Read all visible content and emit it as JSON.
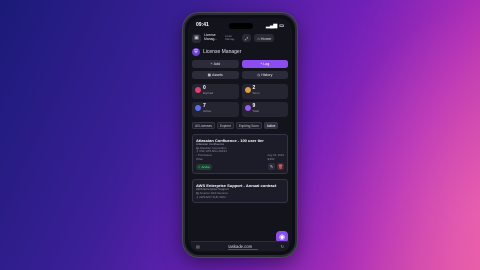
{
  "status": {
    "time": "09:41"
  },
  "topbar": {
    "title_line1": "License",
    "title_line2": "Manag...",
    "subtitle_line1": "Licen",
    "subtitle_line2": "Manag...",
    "pill1": "⤢",
    "pill2": "Home"
  },
  "header": {
    "logo_icon": "shield-icon",
    "title": "License Manager"
  },
  "actions": {
    "add": "Add",
    "log": "Log",
    "assets": "Assets",
    "history": "History"
  },
  "stats": [
    {
      "value": "0",
      "label": "Expired",
      "color": "#e0406a"
    },
    {
      "value": "2",
      "label": "Soon",
      "color": "#e0a040"
    },
    {
      "value": "7",
      "label": "Active",
      "color": "#5a6cf0"
    },
    {
      "value": "9",
      "label": "Total",
      "color": "#9a5af0"
    }
  ],
  "tabs": [
    "All Licenses",
    "Expired",
    "Expiring Soon",
    "Active"
  ],
  "cards": [
    {
      "title": "Atlassian Confluence - 100 user tier",
      "subtitle": "Atlassian Confluence",
      "vendor": "Atlassian Corporation",
      "key": "CNF-HT8-6KH-4NK61",
      "purchased_label": "Purchased",
      "expires": "Aug 15, 2024",
      "type": "Other",
      "price": "$,800",
      "status": "Active"
    },
    {
      "title": "AWS Enterprise Support - Annual contract",
      "subtitle": "AWS Enterprise Support",
      "vendor": "Amazon Web Services",
      "key": "AWS-ENT-SUP-2024"
    }
  ],
  "browser": {
    "url": "taskade.com"
  }
}
